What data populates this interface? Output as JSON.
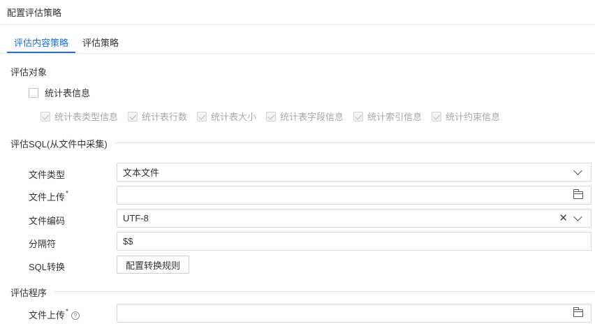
{
  "header": {
    "title": "配置评估策略"
  },
  "tabs": [
    {
      "label": "评估内容策略",
      "active": true
    },
    {
      "label": "评估策略",
      "active": false
    }
  ],
  "sections": {
    "target": "评估对象",
    "sql": "评估SQL(从文件中采集)",
    "program": "评估程序"
  },
  "stats": {
    "main_label": "统计表信息",
    "main_checked": false,
    "sub_items": [
      {
        "label": "统计表类型信息",
        "checked": true,
        "disabled": true
      },
      {
        "label": "统计表行数",
        "checked": true,
        "disabled": true
      },
      {
        "label": "统计表大小",
        "checked": true,
        "disabled": true
      },
      {
        "label": "统计表字段信息",
        "checked": true,
        "disabled": true
      },
      {
        "label": "统计索引信息",
        "checked": true,
        "disabled": true
      },
      {
        "label": "统计约束信息",
        "checked": true,
        "disabled": true
      }
    ]
  },
  "form": {
    "file_type": {
      "label": "文件类型",
      "value": "文本文件",
      "icon": "chevron-down-icon"
    },
    "file_upload": {
      "label": "文件上传",
      "required_mark": "*",
      "value": "",
      "icon": "folder-icon"
    },
    "encoding": {
      "label": "文件编码",
      "value": "UTF-8",
      "clear_glyph": "✕",
      "icon": "chevron-down-icon"
    },
    "delimiter": {
      "label": "分隔符",
      "value": "$$"
    },
    "sql_convert": {
      "label": "SQL转换",
      "button": "配置转换规则"
    }
  },
  "program": {
    "file_upload": {
      "label": "文件上传",
      "required_mark": "*",
      "help_glyph": "?",
      "value": "",
      "icon": "folder-icon"
    }
  },
  "colors": {
    "accent": "#1e6fd9",
    "border": "#d9d9d9",
    "disabled_text": "#a8a8a8"
  }
}
